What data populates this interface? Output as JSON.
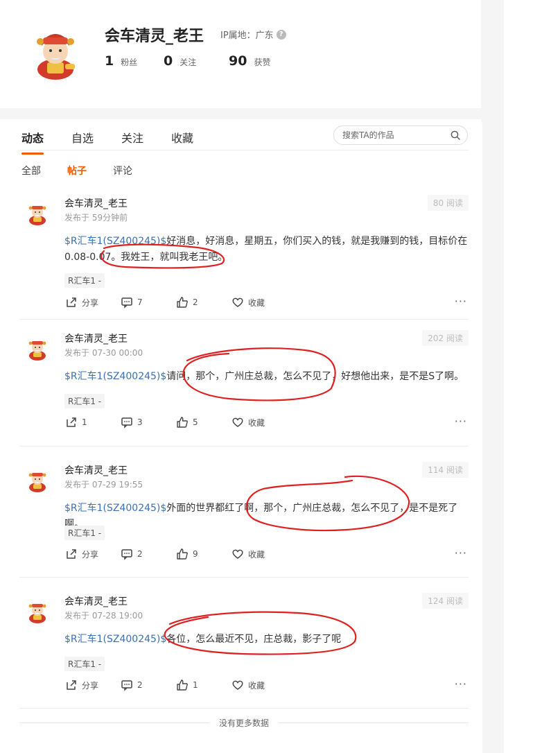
{
  "profile": {
    "username": "会车清灵_老王",
    "ip_label": "IP属地：广东",
    "help_icon": "question-icon",
    "stats": [
      {
        "num": "1",
        "label": "粉丝"
      },
      {
        "num": "0",
        "label": "关注"
      },
      {
        "num": "90",
        "label": "获赞"
      }
    ]
  },
  "tabs": [
    {
      "label": "动态",
      "active": true
    },
    {
      "label": "自选",
      "active": false
    },
    {
      "label": "关注",
      "active": false
    },
    {
      "label": "收藏",
      "active": false
    }
  ],
  "search": {
    "placeholder": "搜索TA的作品"
  },
  "subtabs": [
    {
      "label": "全部",
      "active": false
    },
    {
      "label": "帖子",
      "active": true
    },
    {
      "label": "评论",
      "active": false
    }
  ],
  "posts": [
    {
      "author": "会车清灵_老王",
      "time": "发布于 59分钟前",
      "reads": "80 阅读",
      "stock": "$R汇车1(SZ400245)$",
      "text": "好消息，好消息，星期五，你们买入的钱，就是我赚到的钱，目标价在0.08-0.07。我姓王，就叫我老王吧。",
      "tag": "R汇车1 -",
      "share": "分享",
      "comments": "7",
      "likes": "2",
      "fav": "收藏",
      "more": "···"
    },
    {
      "author": "会车清灵_老王",
      "time": "发布于 07-30 00:00",
      "reads": "202 阅读",
      "stock": "$R汇车1(SZ400245)$",
      "text": "请问，那个，广州庄总裁，怎么不见了，好想他出来，是不是S了啊。",
      "tag": "R汇车1 -",
      "share": "1",
      "comments": "3",
      "likes": "5",
      "fav": "收藏",
      "more": "···"
    },
    {
      "author": "会车清灵_老王",
      "time": "发布于 07-29 19:55",
      "reads": "114 阅读",
      "stock": "$R汇车1(SZ400245)$",
      "text": "外面的世界都红了啊，那个，广州庄总裁，怎么不见了，是不是死了啊。",
      "tag": "R汇车1 -",
      "share": "分享",
      "comments": "2",
      "likes": "9",
      "fav": "收藏",
      "more": "···"
    },
    {
      "author": "会车清灵_老王",
      "time": "发布于 07-28 19:00",
      "reads": "124 阅读",
      "stock": "$R汇车1(SZ400245)$",
      "text": "各位，怎么最近不见，庄总裁，影子了呢",
      "tag": "R汇车1 -",
      "share": "分享",
      "comments": "2",
      "likes": "1",
      "fav": "收藏",
      "more": "···"
    }
  ],
  "footer": {
    "no_more": "没有更多数据"
  },
  "colors": {
    "accent": "#f25a00",
    "stock_link": "#3a6fb5",
    "annotation": "#e02020"
  }
}
